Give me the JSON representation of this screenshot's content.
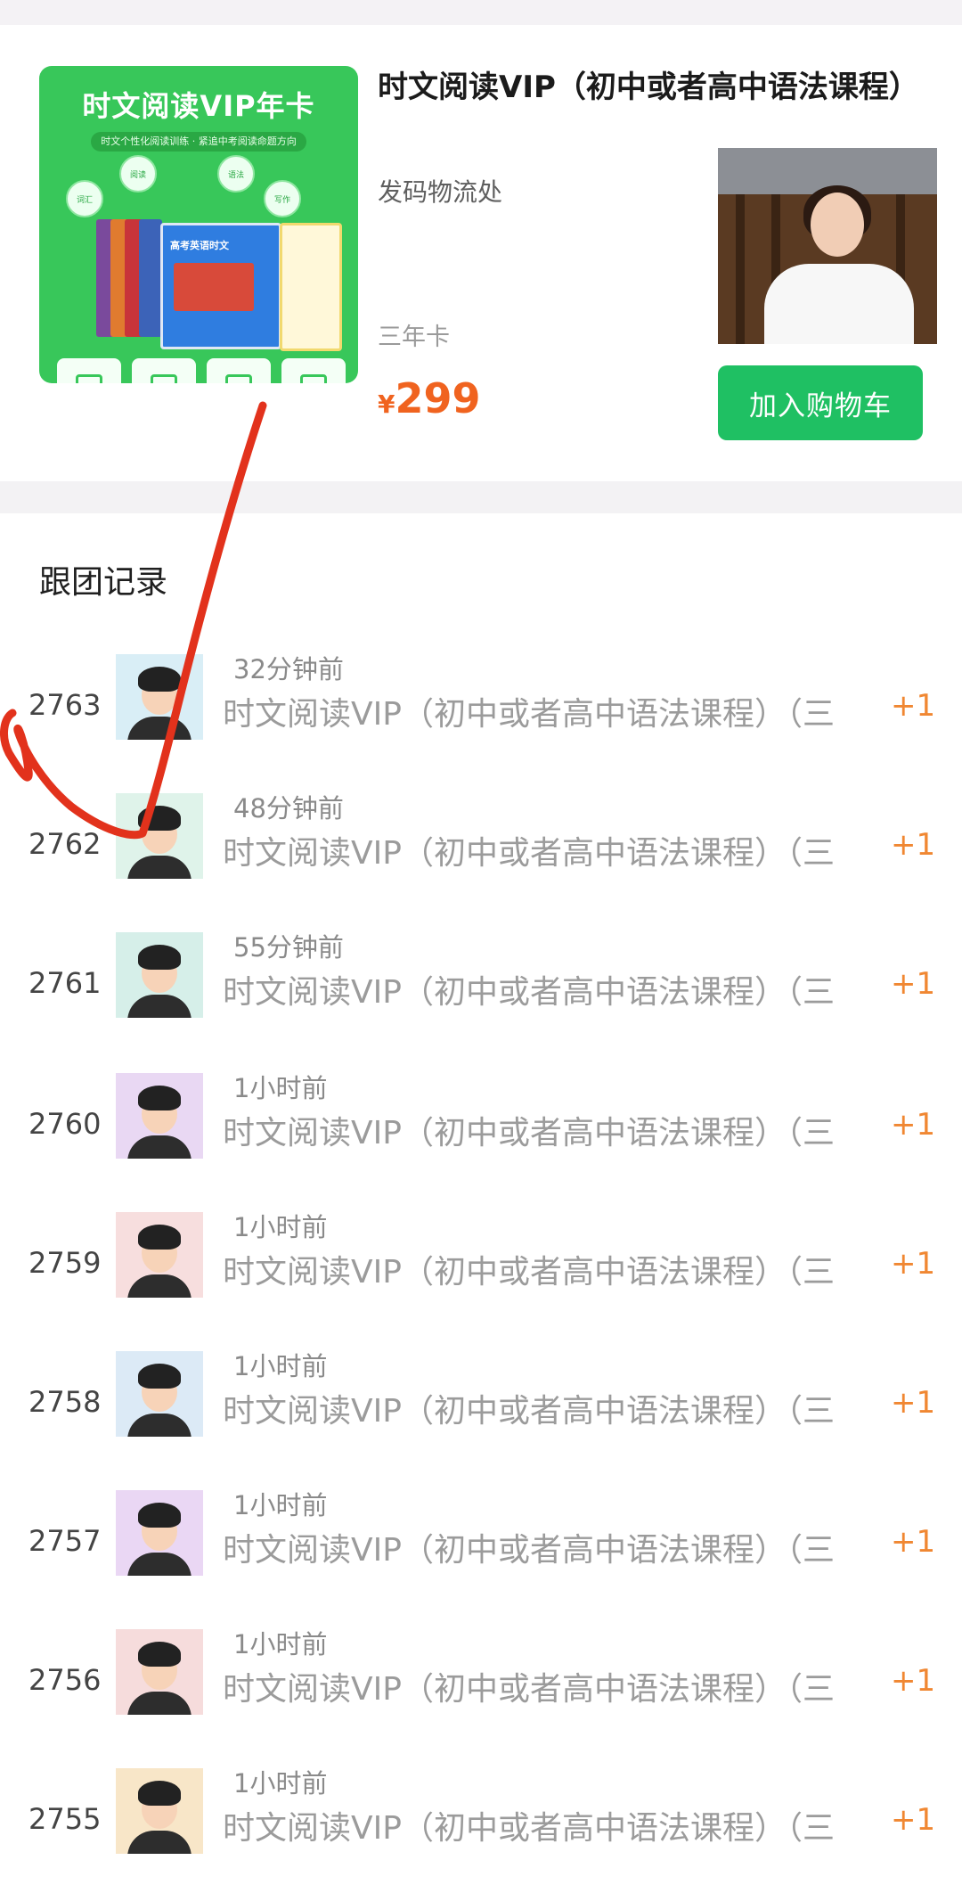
{
  "product": {
    "cover_title": "时文阅读VIP年卡",
    "cover_subtitle": "时文个性化阅读训练 · 紧追中考阅读命题方向",
    "cover_bubbles": [
      "词汇",
      "阅读",
      "语法",
      "写作"
    ],
    "cover_book_label": "高考英语时文",
    "title": "时文阅读VIP（初中或者高中语法课程）",
    "note": "发码物流处",
    "spec": "三年卡",
    "price_symbol": "¥",
    "price": "299",
    "cart_button": "加入购物车"
  },
  "records": {
    "title": "跟团记录",
    "items": [
      {
        "num": "2763",
        "time": "32分钟前",
        "desc": "时文阅读VIP（初中或者高中语法课程）（三",
        "plus": "+1",
        "avatar_bg": "#d9eef6"
      },
      {
        "num": "2762",
        "time": "48分钟前",
        "desc": "时文阅读VIP（初中或者高中语法课程）（三",
        "plus": "+1",
        "avatar_bg": "#dff3ea"
      },
      {
        "num": "2761",
        "time": "55分钟前",
        "desc": "时文阅读VIP（初中或者高中语法课程）（三",
        "plus": "+1",
        "avatar_bg": "#d6efe9"
      },
      {
        "num": "2760",
        "time": "1小时前",
        "desc": "时文阅读VIP（初中或者高中语法课程）（三",
        "plus": "+1",
        "avatar_bg": "#e9d8f3"
      },
      {
        "num": "2759",
        "time": "1小时前",
        "desc": "时文阅读VIP（初中或者高中语法课程）（三",
        "plus": "+1",
        "avatar_bg": "#f7dede"
      },
      {
        "num": "2758",
        "time": "1小时前",
        "desc": "时文阅读VIP（初中或者高中语法课程）（三",
        "plus": "+1",
        "avatar_bg": "#dceaf6"
      },
      {
        "num": "2757",
        "time": "1小时前",
        "desc": "时文阅读VIP（初中或者高中语法课程）（三",
        "plus": "+1",
        "avatar_bg": "#ead7f4"
      },
      {
        "num": "2756",
        "time": "1小时前",
        "desc": "时文阅读VIP（初中或者高中语法课程）（三",
        "plus": "+1",
        "avatar_bg": "#f6dcdc"
      },
      {
        "num": "2755",
        "time": "1小时前",
        "desc": "时文阅读VIP（初中或者高中语法课程）（三",
        "plus": "+1",
        "avatar_bg": "#f8e6c8"
      }
    ]
  },
  "colors": {
    "price": "#f0631f",
    "cart_button": "#1fc063",
    "plus": "#f08732",
    "annotation": "#e2321c"
  }
}
